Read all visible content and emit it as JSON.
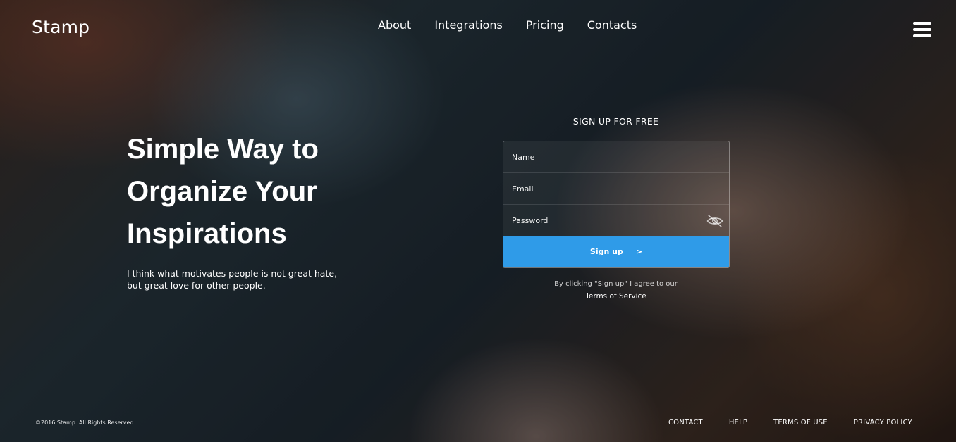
{
  "header": {
    "brand": "Stamp",
    "nav": [
      "About",
      "Integrations",
      "Pricing",
      "Contacts"
    ],
    "menu_icon": "hamburger-menu-icon"
  },
  "hero": {
    "title": "Simple Way to Organize Your Inspirations",
    "subtitle": "I think what motivates people is not great hate, but great love for other people."
  },
  "signup": {
    "heading": "SIGN UP FOR FREE",
    "name_placeholder": "Name",
    "email_placeholder": "Email",
    "password_placeholder": "Password",
    "password_toggle_icon": "eye-off-icon",
    "button_label": "Sign up",
    "button_arrow": ">",
    "agree_text": "By clicking \"Sign up\" I agree to our",
    "tos_link": "Terms of Service",
    "button_color": "#2f9be8"
  },
  "footer": {
    "copyright": "©2016 Stamp. All Rights Reserved",
    "links": [
      "CONTACT",
      "HELP",
      "TERMS OF USE",
      "PRIVACY POLICY"
    ]
  }
}
